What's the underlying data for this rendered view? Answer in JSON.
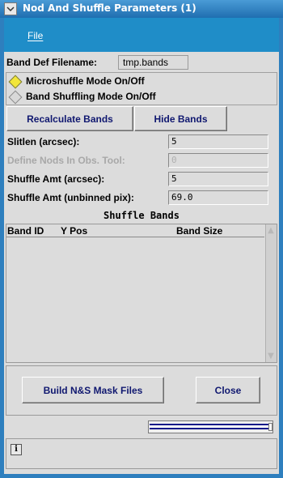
{
  "window": {
    "title": "Nod And Shuffle Parameters (1)"
  },
  "menubar": {
    "file_label": "File"
  },
  "band_def": {
    "label": "Band Def Filename:",
    "value": "tmp.bands"
  },
  "modes": [
    {
      "label": "Microshuffle Mode On/Off",
      "selected": true
    },
    {
      "label": "Band Shuffling Mode On/Off",
      "selected": false
    }
  ],
  "buttons": {
    "recalculate": "Recalculate Bands",
    "hide": "Hide Bands",
    "build": "Build N&S Mask Files",
    "close": "Close"
  },
  "params": [
    {
      "label": "Slitlen (arcsec):",
      "value": "5",
      "enabled": true
    },
    {
      "label": "Define Nods In Obs. Tool:",
      "value": "0",
      "enabled": false
    },
    {
      "label": "Shuffle Amt (arcsec):",
      "value": "5",
      "enabled": true
    },
    {
      "label": "Shuffle Amt (unbinned pix):",
      "value": "69.0",
      "enabled": true
    }
  ],
  "bands": {
    "title": "Shuffle Bands",
    "columns": [
      "Band ID",
      "Y Pos",
      "Band Size"
    ],
    "rows": []
  },
  "status": {
    "icon": "info-icon",
    "text": ""
  },
  "colors": {
    "titlebar": "#2e7fbe",
    "menubar": "#1f8dc8",
    "button_text": "#101870",
    "radio_selected": "#f2e63a",
    "progress": "#121a8a"
  }
}
